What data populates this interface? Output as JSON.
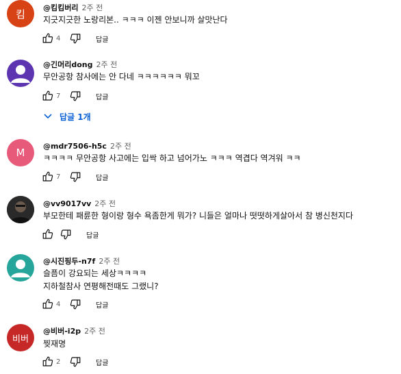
{
  "comments": [
    {
      "author": "@킴킴버리",
      "time": "2주 전",
      "text": "지긋지긋한 노랑리본.. ㅋㅋㅋ 이젠 안보니까 살맛난다",
      "likes": "4",
      "reply_label": "답글",
      "avatar": {
        "type": "text",
        "text": "킴",
        "color": "#d84315"
      }
    },
    {
      "author": "@긴머리dong",
      "time": "2주 전",
      "text": "무안공항 참사에는 안 다네 ㅋㅋㅋㅋㅋㅋ 뭐꼬",
      "likes": "7",
      "reply_label": "답글",
      "avatar": {
        "type": "person",
        "color": "#5e35b1"
      },
      "replies_label": "답글 1개"
    },
    {
      "author": "@mdr7506-h5c",
      "time": "2주 전",
      "text": "ㅋㅋㅋㅋ 무안공항 사고에는 입싹 하고 넘어가노 ㅋㅋㅋ 역겹다 역겨워 ㅋㅋ",
      "likes": "7",
      "reply_label": "답글",
      "avatar": {
        "type": "text",
        "text": "M",
        "color": "#e85a7a"
      }
    },
    {
      "author": "@vv9017vv",
      "time": "2주 전",
      "text": "부모한테 패륜한 형이랑 형수 욕좀한게 뭐가? 니들은 얼마나 떳떳하게살아서 참 병신천지다",
      "likes": "",
      "reply_label": "답글",
      "avatar": {
        "type": "photo",
        "color": "#1b1b1b"
      }
    },
    {
      "author": "@시진핑두-n7f",
      "time": "2주 전",
      "text": "슬픔이 강요되는 세상ㅋㅋㅋㅋ\n지하철참사 연평해전때도 그랬니?",
      "likes": "4",
      "reply_label": "답글",
      "avatar": {
        "type": "person",
        "color": "#26a69a"
      }
    },
    {
      "author": "@비버-i2p",
      "time": "2주 전",
      "text": "찢재명",
      "likes": "2",
      "reply_label": "답글",
      "avatar": {
        "type": "text",
        "text": "비버",
        "color": "#c62828"
      }
    }
  ]
}
